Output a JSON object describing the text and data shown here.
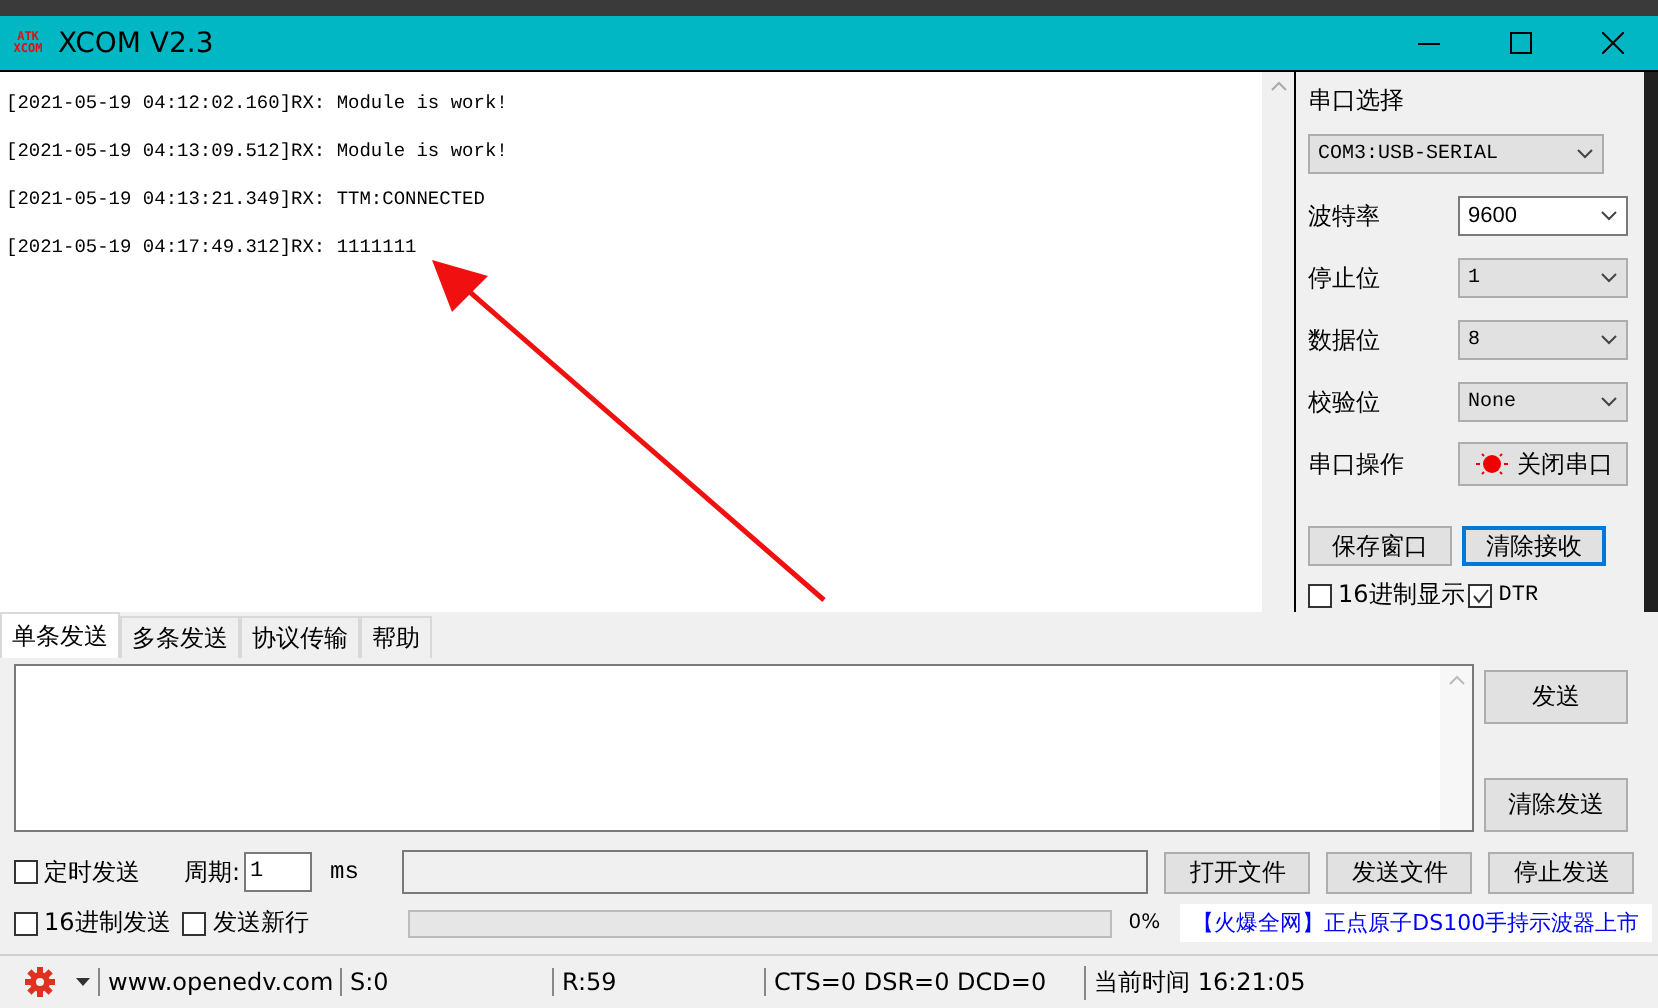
{
  "window": {
    "title": "XCOM V2.3",
    "logo_top": "ATK",
    "logo_bottom": "XCOM"
  },
  "receive": {
    "lines": [
      "[2021-05-19 04:12:02.160]RX: Module is work!",
      "[2021-05-19 04:13:09.512]RX: Module is work!",
      "[2021-05-19 04:13:21.349]RX: TTM:CONNECTED",
      "[2021-05-19 04:17:49.312]RX: 1111111"
    ]
  },
  "settings": [
    {
      "kind": "wide",
      "label": "串口选择",
      "value": "COM3:USB-SERIAL"
    },
    {
      "kind": "editable",
      "label": "波特率",
      "value": "9600"
    },
    {
      "kind": "select",
      "label": "停止位",
      "value": "1"
    },
    {
      "kind": "select",
      "label": "数据位",
      "value": "8"
    },
    {
      "kind": "select",
      "label": "校验位",
      "value": "None"
    }
  ],
  "port": {
    "label": "串口操作",
    "button": "关闭串口",
    "on": true
  },
  "panel_buttons": [
    {
      "label": "保存窗口",
      "selected": false
    },
    {
      "label": "清除接收",
      "selected": true
    }
  ],
  "panel_checks": [
    {
      "label": "16进制显示",
      "checked": false
    },
    {
      "label": "DTR",
      "checked": true
    }
  ],
  "tabs": [
    {
      "label": "单条发送",
      "selected": true
    },
    {
      "label": "多条发送",
      "selected": false
    },
    {
      "label": "协议传输",
      "selected": false
    },
    {
      "label": "帮助",
      "selected": false
    }
  ],
  "send_buttons": [
    "发送",
    "清除发送"
  ],
  "timed": {
    "label": "定时发送",
    "checked": false
  },
  "period": {
    "label": "周期:",
    "value": "1",
    "unit": "ms"
  },
  "file_buttons": [
    "打开文件",
    "发送文件",
    "停止发送"
  ],
  "options": [
    {
      "label": "16进制发送",
      "checked": false
    },
    {
      "label": "发送新行",
      "checked": false
    }
  ],
  "progress": {
    "level": 0,
    "reading": "0%"
  },
  "ad": "【火爆全网】正点原子DS100手持示波器上市",
  "status_bar": {
    "url": "www.openedv.com",
    "sent": "S:0",
    "received": "R:59",
    "lines": "CTS=0 DSR=0 DCD=0",
    "time": "当前时间 16:21:05"
  }
}
